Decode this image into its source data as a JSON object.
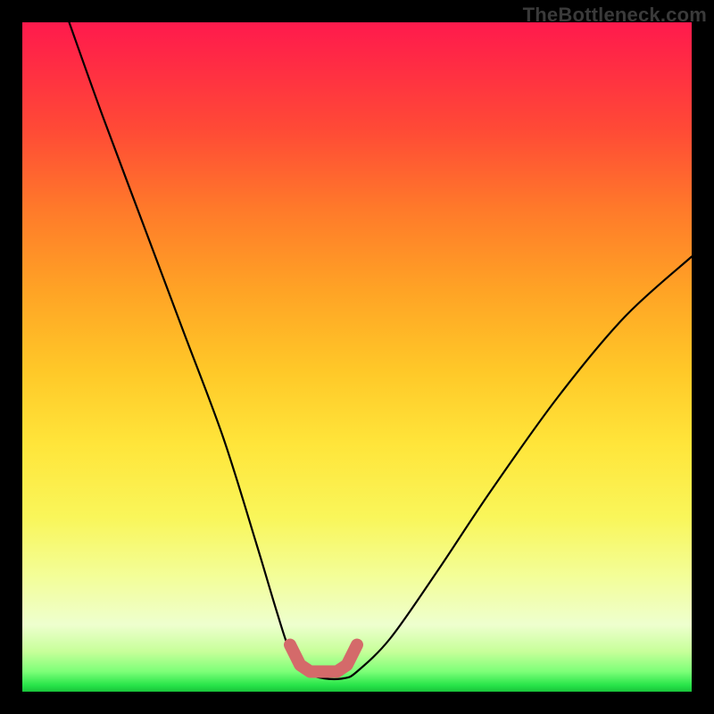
{
  "watermark": {
    "text": "TheBottleneck.com"
  },
  "chart_data": {
    "type": "line",
    "title": "",
    "xlabel": "",
    "ylabel": "",
    "xlim": [
      0,
      100
    ],
    "ylim": [
      0,
      100
    ],
    "series": [
      {
        "name": "bottleneck-curve",
        "x": [
          7,
          12,
          18,
          24,
          30,
          35,
          38,
          40,
          42,
          45,
          48,
          50,
          55,
          62,
          70,
          80,
          90,
          100
        ],
        "values": [
          100,
          86,
          70,
          54,
          38,
          22,
          12,
          6,
          3,
          2,
          2,
          3,
          8,
          18,
          30,
          44,
          56,
          65
        ]
      }
    ],
    "annotations": [
      {
        "name": "optimal-range-highlight",
        "x_range": [
          40,
          50
        ],
        "y": 3,
        "color": "#d46a6a"
      }
    ]
  }
}
